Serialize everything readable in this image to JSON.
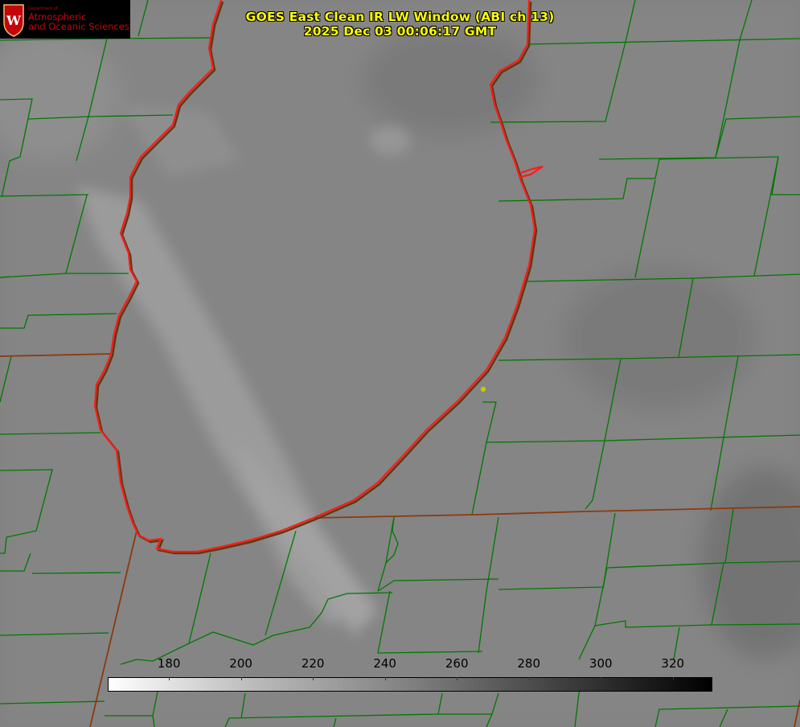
{
  "product": {
    "title": "GOES East Clean IR LW Window (ABI ch 13)",
    "timestamp": "2025 Dec 03 00:06:17 GMT"
  },
  "logo": {
    "dept_line": "Department of",
    "name_line1": "Atmospheric",
    "name_line2": "and Oceanic Sciences"
  },
  "colorbar": {
    "ticks": [
      "180",
      "200",
      "220",
      "240",
      "260",
      "280",
      "300",
      "320"
    ],
    "range": [
      163,
      331
    ],
    "colormap": "white-to-black grayscale"
  },
  "colors": {
    "background_gray": "#808080",
    "county_lines": "#007800",
    "state_lines": "#8b3a0f",
    "shoreline": "#ff1a1a",
    "title_text": "#ffff00",
    "site_marker": "#c8c800"
  }
}
